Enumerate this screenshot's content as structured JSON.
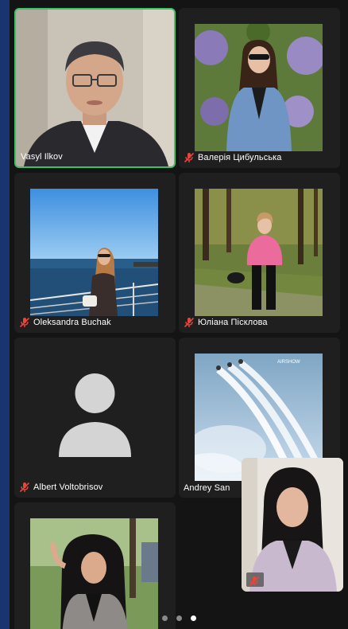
{
  "participants": [
    {
      "name": "Vasyl Ilkov",
      "muted": false
    },
    {
      "name": "Валерія Цибульська",
      "muted": true
    },
    {
      "name": "Oleksandra Buchak",
      "muted": true
    },
    {
      "name": "Юліана Пісклова",
      "muted": true
    },
    {
      "name": "Albert Voltobrisov",
      "muted": true
    },
    {
      "name": "Andrey San",
      "muted": false
    },
    {
      "name": "",
      "muted": false
    }
  ],
  "airshow_watermark": "AIRSHOW",
  "pagination": {
    "pages": 3,
    "current": 3
  },
  "colors": {
    "active_speaker": "#37c46a",
    "mute_icon": "#e8453c",
    "tile_bg": "#1f1f1f",
    "screen_bg": "#141414",
    "frame_bg": "#1a3470"
  }
}
